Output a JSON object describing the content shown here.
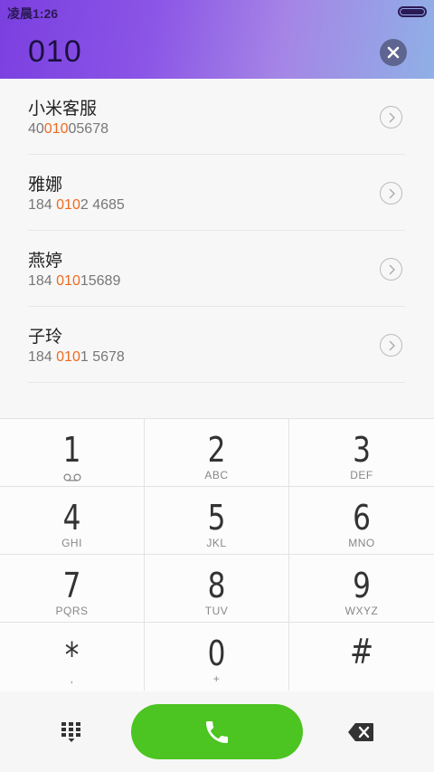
{
  "status": {
    "time": "凌晨1:26"
  },
  "dial": {
    "number": "010"
  },
  "contacts": [
    {
      "name": "小米客服",
      "num_pre": "40",
      "num_hl": "010",
      "num_post": "05678"
    },
    {
      "name": "雅娜",
      "num_pre": "184 ",
      "num_hl": "010",
      "num_post": "2 4685"
    },
    {
      "name": "燕婷",
      "num_pre": "184 ",
      "num_hl": "010",
      "num_post": "15689"
    },
    {
      "name": "子玲",
      "num_pre": "184 ",
      "num_hl": "010",
      "num_post": "1 5678"
    }
  ],
  "keys": [
    {
      "digit": "1",
      "letters": ""
    },
    {
      "digit": "2",
      "letters": "ABC"
    },
    {
      "digit": "3",
      "letters": "DEF"
    },
    {
      "digit": "4",
      "letters": "GHI"
    },
    {
      "digit": "5",
      "letters": "JKL"
    },
    {
      "digit": "6",
      "letters": "MNO"
    },
    {
      "digit": "7",
      "letters": "PQRS"
    },
    {
      "digit": "8",
      "letters": "TUV"
    },
    {
      "digit": "9",
      "letters": "WXYZ"
    },
    {
      "digit": "*",
      "letters": ","
    },
    {
      "digit": "0",
      "letters": "+"
    },
    {
      "digit": "#",
      "letters": ""
    }
  ],
  "colors": {
    "highlight": "#f06a1e",
    "call": "#4cc421"
  }
}
